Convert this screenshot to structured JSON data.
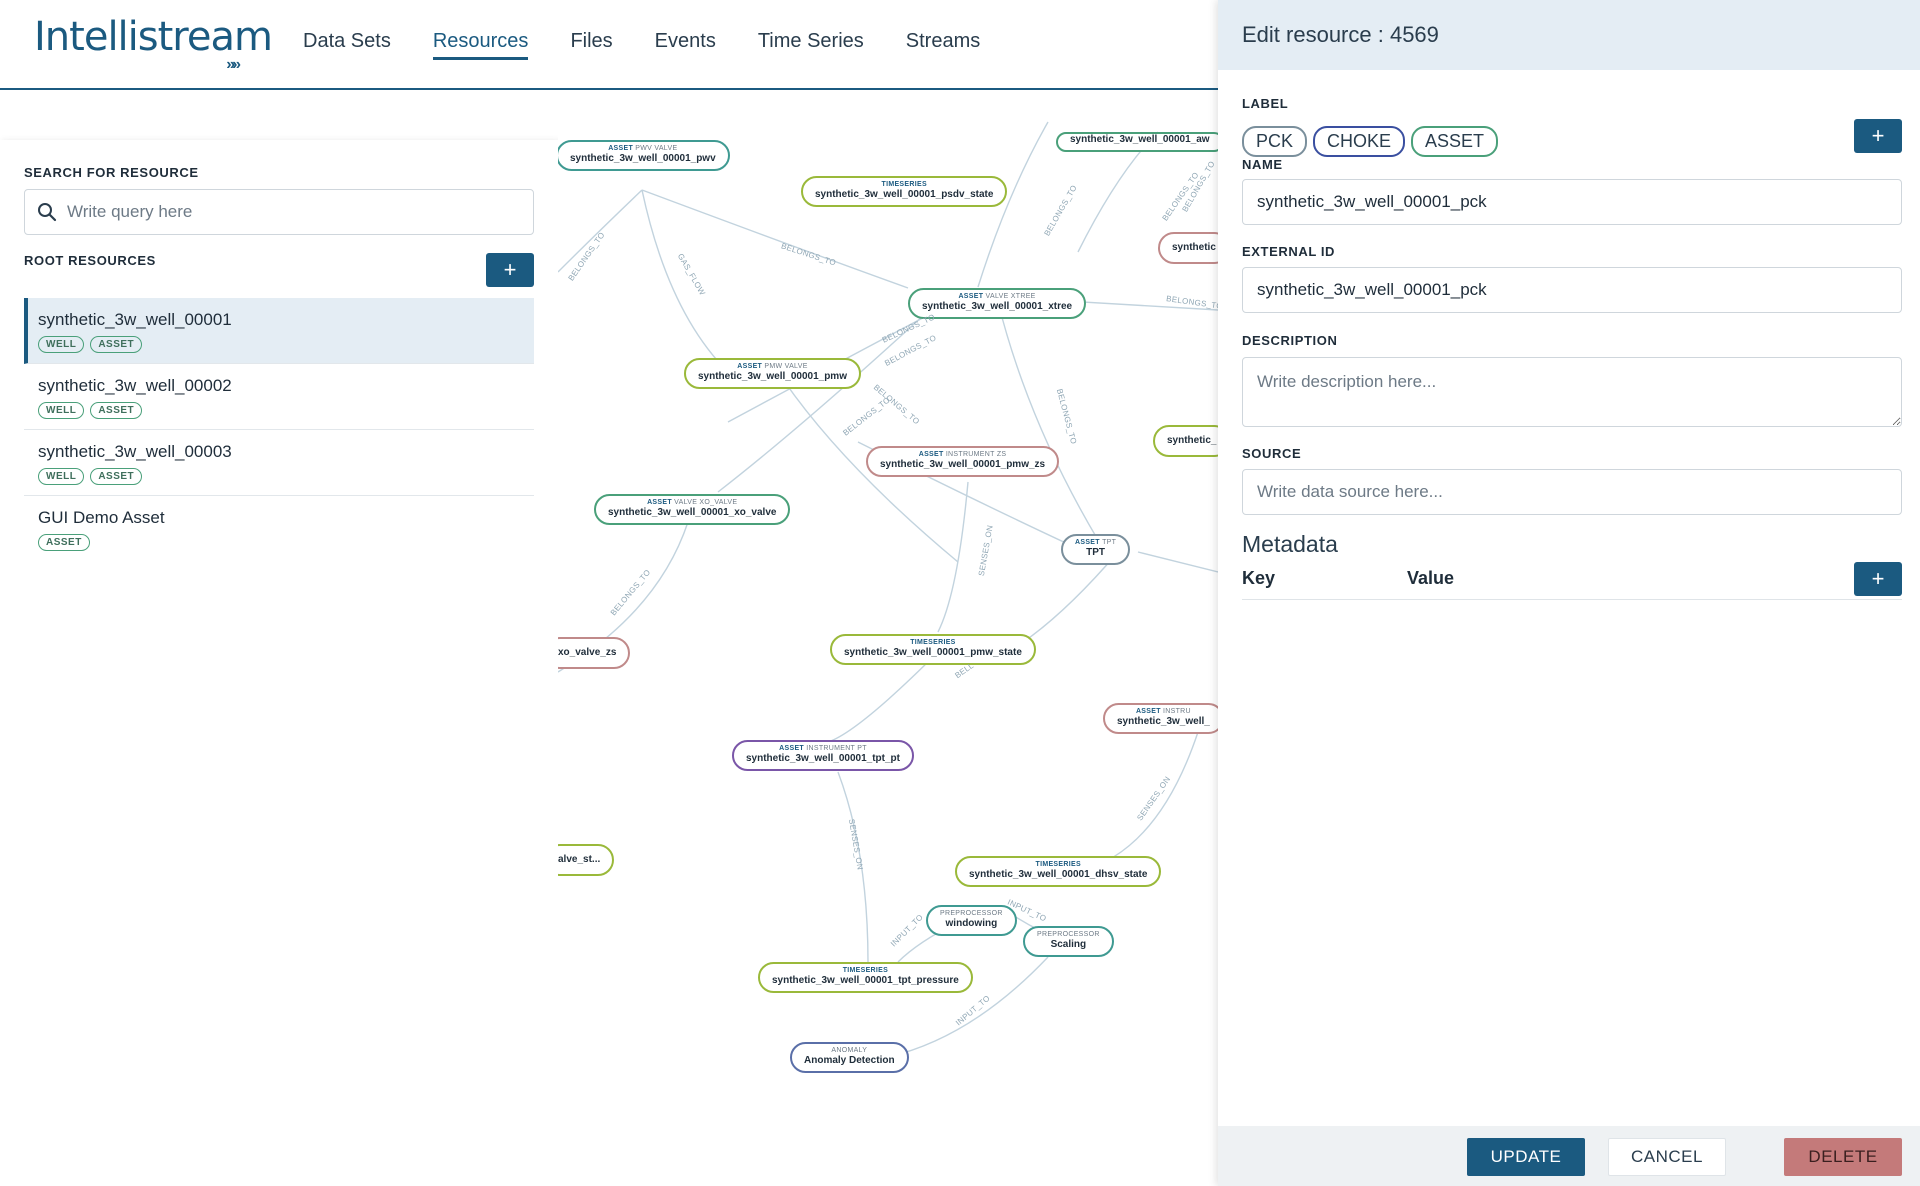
{
  "header": {
    "logo_text": "Intellistream",
    "logo_chevrons": "»»",
    "nav": [
      {
        "label": "Data Sets"
      },
      {
        "label": "Resources"
      },
      {
        "label": "Files"
      },
      {
        "label": "Events"
      },
      {
        "label": "Time Series"
      },
      {
        "label": "Streams"
      }
    ],
    "active_nav": "Resources"
  },
  "left_panel": {
    "search_label": "SEARCH FOR RESOURCE",
    "search_placeholder": "Write query here",
    "root_label": "ROOT RESOURCES",
    "add_label": "+",
    "resources": [
      {
        "name": "synthetic_3w_well_00001",
        "tags": [
          "WELL",
          "ASSET"
        ]
      },
      {
        "name": "synthetic_3w_well_00002",
        "tags": [
          "WELL",
          "ASSET"
        ]
      },
      {
        "name": "synthetic_3w_well_00003",
        "tags": [
          "WELL",
          "ASSET"
        ]
      },
      {
        "name": "GUI Demo Asset",
        "tags": [
          "ASSET"
        ]
      }
    ]
  },
  "graph": {
    "nodes": [
      {
        "type": "ASSET",
        "sub": "PWV VALVE",
        "name": "synthetic_3w_well_00001_pwv",
        "color": "#3f9a92"
      },
      {
        "type": "TIMESERIES",
        "sub": "",
        "name": "synthetic_3w_well_00001_psdv_state",
        "color": "#9ab93a"
      },
      {
        "type": "",
        "sub": "",
        "name": "synthetic_3w_well_00001_aw",
        "color": "#4aa07a"
      },
      {
        "type": "",
        "sub": "",
        "name": "synthetic",
        "color": "#c08a8a"
      },
      {
        "type": "ASSET",
        "sub": "VALVE XTREE",
        "name": "synthetic_3w_well_00001_xtree",
        "color": "#4aa07a"
      },
      {
        "type": "ASSET",
        "sub": "PMW VALVE",
        "name": "synthetic_3w_well_00001_pmw",
        "color": "#9ab93a"
      },
      {
        "type": "",
        "sub": "",
        "name": "synthetic_",
        "color": "#9ab93a"
      },
      {
        "type": "ASSET",
        "sub": "INSTRUMENT ZS",
        "name": "synthetic_3w_well_00001_pmw_zs",
        "color": "#c08a8a"
      },
      {
        "type": "ASSET",
        "sub": "VALVE XO_VALVE",
        "name": "synthetic_3w_well_00001_xo_valve",
        "color": "#4aa07a"
      },
      {
        "type": "ASSET",
        "sub": "TPT",
        "name": "TPT",
        "color": "#7a8f9c"
      },
      {
        "type": "",
        "sub": "",
        "name": "xo_valve_zs",
        "color": "#c08a8a"
      },
      {
        "type": "TIMESERIES",
        "sub": "",
        "name": "synthetic_3w_well_00001_pmw_state",
        "color": "#9ab93a"
      },
      {
        "type": "ASSET",
        "sub": "INSTRU",
        "name": "synthetic_3w_well_",
        "color": "#c08a8a"
      },
      {
        "type": "ASSET",
        "sub": "INSTRUMENT PT",
        "name": "synthetic_3w_well_00001_tpt_pt",
        "color": "#7a56a8"
      },
      {
        "type": "",
        "sub": "",
        "name": "alve_st...",
        "color": "#9ab93a"
      },
      {
        "type": "TIMESERIES",
        "sub": "",
        "name": "synthetic_3w_well_00001_dhsv_state",
        "color": "#9ab93a"
      },
      {
        "type": "PREPROCESSOR",
        "sub": "",
        "name": "windowing",
        "color": "#3f9a92"
      },
      {
        "type": "PREPROCESSOR",
        "sub": "",
        "name": "Scaling",
        "color": "#3f9a92"
      },
      {
        "type": "TIMESERIES",
        "sub": "",
        "name": "synthetic_3w_well_00001_tpt_pressure",
        "color": "#9ab93a"
      },
      {
        "type": "ANOMALY",
        "sub": "",
        "name": "Anomaly Detection",
        "color": "#5a6fa8"
      }
    ],
    "edge_labels": [
      "BELONGS_TO",
      "GAS_FLOW",
      "BELONGS_TO",
      "BELONGS_TO",
      "BELONGS_TO",
      "BELONGS_TO",
      "BELONGS_TO",
      "BELONGS_TO",
      "BELONGS_TO",
      "SENSES_ON",
      "BELONGS_TO",
      "BELONGS_TO",
      "SENSES_ON",
      "INPUT_TO",
      "INPUT_TO",
      "INPUT_TO",
      "SENSES_ON",
      "BELONGS_TO",
      "BELONGS_TO",
      "BELL"
    ]
  },
  "editor": {
    "title": "Edit resource : 4569",
    "label_title": "LABEL",
    "labels": [
      {
        "text": "PCK",
        "color": "#7a8f9c"
      },
      {
        "text": "CHOKE",
        "color": "#3a4fa0"
      },
      {
        "text": "ASSET",
        "color": "#4aa07a"
      }
    ],
    "add_label": "+",
    "name_title": "NAME",
    "name_value": "synthetic_3w_well_00001_pck",
    "external_title": "EXTERNAL ID",
    "external_value": "synthetic_3w_well_00001_pck",
    "description_title": "DESCRIPTION",
    "description_placeholder": "Write description here...",
    "source_title": "SOURCE",
    "source_placeholder": "Write data source here...",
    "metadata_title": "Metadata",
    "key_label": "Key",
    "value_label": "Value",
    "buttons": {
      "update": "UPDATE",
      "cancel": "CANCEL",
      "delete": "DELETE"
    },
    "colors": {
      "update": "#1b5a80",
      "delete": "#c47a7a"
    }
  }
}
